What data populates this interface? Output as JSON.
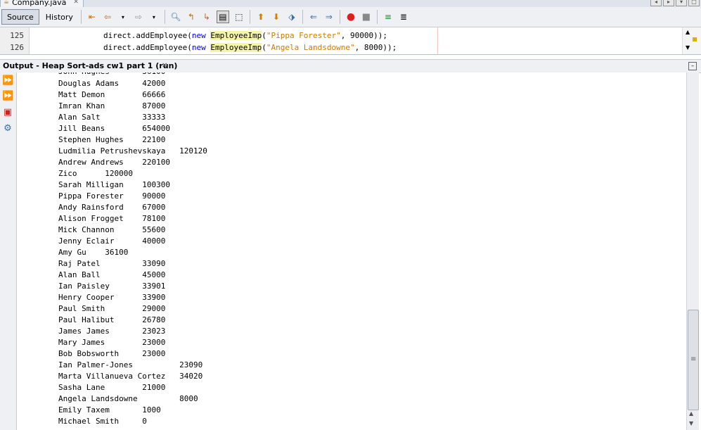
{
  "tab": {
    "label": "Company.java"
  },
  "toolbar": {
    "source_label": "Source",
    "history_label": "History"
  },
  "editor": {
    "lines": [
      {
        "num": "125",
        "pre": "direct.addEmployee(",
        "kw": "new",
        "cls": "EmployeeImp",
        "open": "(",
        "str": "\"Pippa Forester\"",
        "post": ", 90000));"
      },
      {
        "num": "126",
        "pre": "direct.addEmployee(",
        "kw": "new",
        "cls": "EmployeeImp",
        "open": "(",
        "str": "\"Angela Landsdowne\"",
        "post": ", 8000));"
      }
    ]
  },
  "output": {
    "title": "Output - Heap Sort-ads cw1 part 1 (run)",
    "lines": [
      "Douglas Adams     42000",
      "Matt Demon        66666",
      "Imran Khan        87000",
      "Alan Salt         33333",
      "Jill Beans        654000",
      "Stephen Hughes    22100",
      "Ludmilia Petrushevskaya   120120",
      "Andrew Andrews    220100",
      "Zico      120000",
      "Sarah Milligan    100300",
      "Pippa Forester    90000",
      "Andy Rainsford    67000",
      "Alison Frogget    78100",
      "Mick Channon      55600",
      "Jenny Eclair      40000",
      "Amy Gu    36100",
      "Raj Patel         33090",
      "Alan Ball         45000",
      "Ian Paisley       33901",
      "Henry Cooper      33900",
      "Paul Smith        29000",
      "Paul Halibut      26780",
      "James James       23023",
      "Mary James        23000",
      "Bob Bobsworth     23000",
      "Ian Palmer-Jones          23090",
      "Marta Villanueva Cortez   34020",
      "Sasha Lane        21000",
      "Angela Landsdowne         8000",
      "Emily Taxem       1000",
      "Michael Smith     0"
    ]
  }
}
